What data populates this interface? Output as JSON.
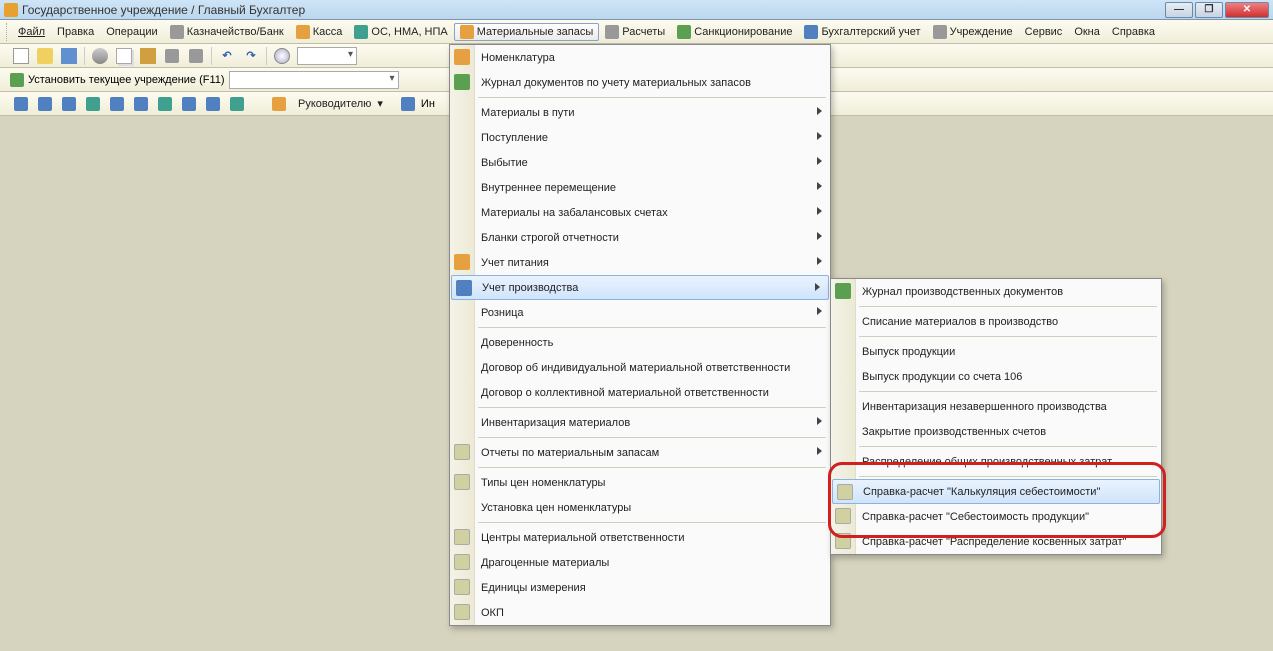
{
  "title": "Государственное учреждение / Главный Бухгалтер",
  "win_min": "—",
  "win_max": "❐",
  "win_close": "✕",
  "menubar": {
    "file": "Файл",
    "edit": "Правка",
    "operations": "Операции",
    "treasury": "Казначейство/Банк",
    "cash": "Касса",
    "os": "ОС, НМА, НПА",
    "inventory": "Материальные запасы",
    "calc": "Расчеты",
    "sanction": "Санкционирование",
    "accounting": "Бухгалтерский учет",
    "institution": "Учреждение",
    "service": "Сервис",
    "windows": "Окна",
    "help": "Справка"
  },
  "toolbar2": {
    "set_current": "Установить текущее учреждение (F11)"
  },
  "toolbar3": {
    "manager": "Руководителю",
    "in": "Ин"
  },
  "dropdown1": [
    {
      "label": "Номенклатура",
      "icon": "orange"
    },
    {
      "label": "Журнал документов по учету материальных запасов",
      "icon": "green"
    },
    {
      "sep": true
    },
    {
      "label": "Материалы в пути",
      "sub": true
    },
    {
      "label": "Поступление",
      "sub": true
    },
    {
      "label": "Выбытие",
      "sub": true
    },
    {
      "label": "Внутреннее перемещение",
      "sub": true
    },
    {
      "label": "Материалы на забалансовых счетах",
      "sub": true
    },
    {
      "label": "Бланки строгой отчетности",
      "sub": true
    },
    {
      "label": "Учет питания",
      "sub": true,
      "icon": "orange"
    },
    {
      "label": "Учет производства",
      "sub": true,
      "hl": true,
      "icon": "blue"
    },
    {
      "label": "Розница",
      "sub": true
    },
    {
      "sep": true
    },
    {
      "label": "Доверенность"
    },
    {
      "label": "Договор об индивидуальной материальной ответственности"
    },
    {
      "label": "Договор о коллективной материальной ответственности"
    },
    {
      "sep": true
    },
    {
      "label": "Инвентаризация материалов",
      "sub": true
    },
    {
      "sep": true
    },
    {
      "label": "Отчеты по материальным запасам",
      "sub": true,
      "icon": "report"
    },
    {
      "sep": true
    },
    {
      "label": "Типы цен номенклатуры",
      "icon": "report"
    },
    {
      "label": "Установка цен номенклатуры"
    },
    {
      "sep": true
    },
    {
      "label": "Центры материальной ответственности",
      "icon": "report"
    },
    {
      "label": "Драгоценные материалы",
      "icon": "report"
    },
    {
      "label": "Единицы измерения",
      "icon": "report"
    },
    {
      "label": "ОКП",
      "icon": "report"
    }
  ],
  "dropdown2": [
    {
      "label": "Журнал производственных документов",
      "icon": "green"
    },
    {
      "sep": true
    },
    {
      "label": "Списание материалов в производство"
    },
    {
      "sep": true
    },
    {
      "label": "Выпуск продукции"
    },
    {
      "label": "Выпуск продукции со счета 106"
    },
    {
      "sep": true
    },
    {
      "label": "Инвентаризация незавершенного производства"
    },
    {
      "label": "Закрытие производственных счетов"
    },
    {
      "sep": true
    },
    {
      "label": "Распределение общих производственных затрат"
    },
    {
      "sep": true
    },
    {
      "label": "Справка-расчет \"Калькуляция себестоимости\"",
      "icon": "report",
      "hl": true
    },
    {
      "label": "Справка-расчет \"Себестоимость продукции\"",
      "icon": "report"
    },
    {
      "label": "Справка-расчет \"Распределение косвенных затрат\"",
      "icon": "report"
    }
  ]
}
